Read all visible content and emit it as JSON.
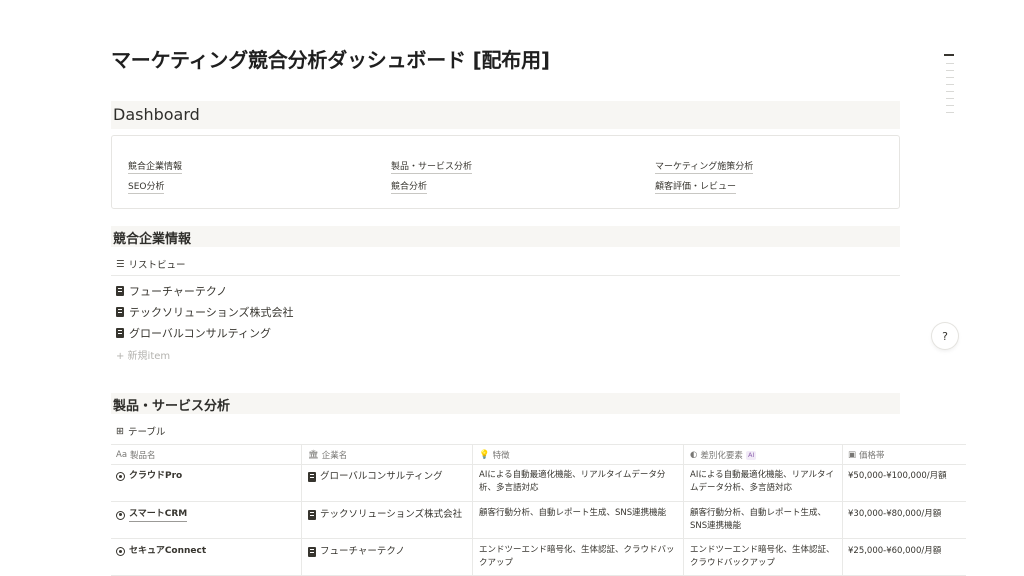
{
  "page": {
    "title": "マーケティング競合分析ダッシュボード [配布用]"
  },
  "dashboard": {
    "heading": "Dashboard",
    "links": [
      "競合企業情報",
      "製品・サービス分析",
      "マーケティング施策分析",
      "SEO分析",
      "競合分析",
      "顧客評価・レビュー"
    ]
  },
  "competitors": {
    "heading": "競合企業情報",
    "view_icon": "list-icon",
    "view_label": "リストビュー",
    "items": [
      "フューチャーテクノ",
      "テックソリューションズ株式会社",
      "グローバルコンサルティング"
    ],
    "new_item": "+ 新規item"
  },
  "products": {
    "heading": "製品・サービス分析",
    "view_icon": "table-icon",
    "view_label": "テーブル",
    "columns": [
      {
        "icon": "Aa",
        "label": "製品名"
      },
      {
        "icon": "🏛",
        "label": "企業名"
      },
      {
        "icon": "💡",
        "label": "特徴"
      },
      {
        "icon": "◐",
        "label": "差別化要素",
        "badge": "AI"
      },
      {
        "icon": "▣",
        "label": "価格帯"
      }
    ],
    "rows": [
      {
        "name": "クラウドPro",
        "company": "グローバルコンサルティング",
        "feature": "AIによる自動最適化機能、リアルタイムデータ分析、多言語対応",
        "diff": "AIによる自動最適化機能、リアルタイムデータ分析、多言語対応",
        "price": "¥50,000-¥100,000/月額"
      },
      {
        "name": "スマートCRM",
        "company": "テックソリューションズ株式会社",
        "feature": "顧客行動分析、自動レポート生成、SNS連携機能",
        "diff": "顧客行動分析、自動レポート生成、SNS連携機能",
        "price": "¥30,000-¥80,000/月額"
      },
      {
        "name": "セキュアConnect",
        "company": "フューチャーテクノ",
        "feature": "エンドツーエンド暗号化、生体認証、クラウドバックアップ",
        "diff": "エンドツーエンド暗号化、生体認証、クラウドバックアップ",
        "price": "¥25,000-¥60,000/月額"
      }
    ]
  },
  "help_button": {
    "label": "?"
  }
}
